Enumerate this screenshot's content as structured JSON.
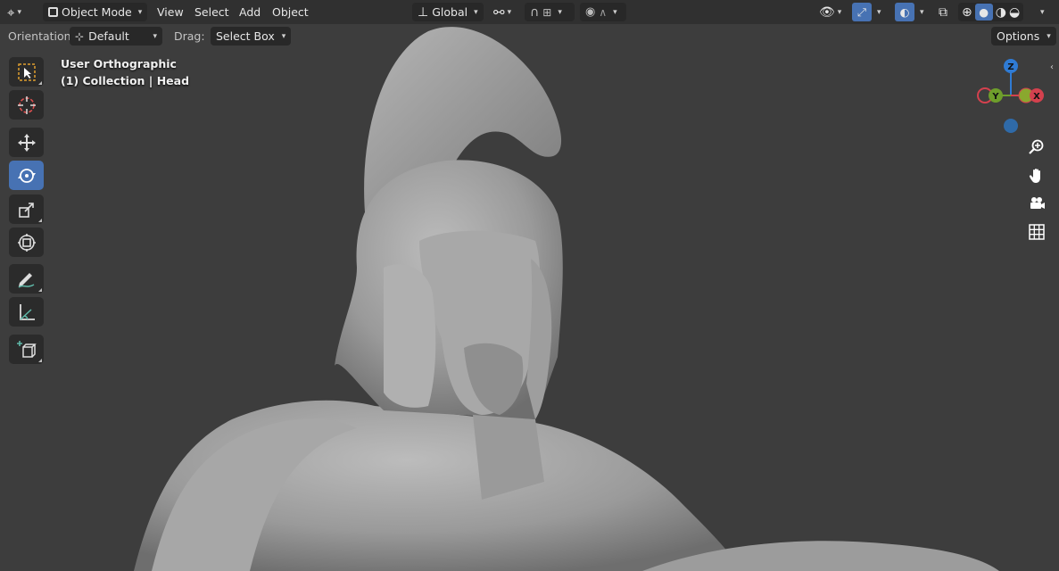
{
  "header": {
    "mode_label": "Object Mode",
    "menus": [
      "View",
      "Select",
      "Add",
      "Object"
    ],
    "transform_orientation": "Global"
  },
  "tool_settings": {
    "orientation_label": "Orientation:",
    "orientation_value": "Default",
    "drag_label": "Drag:",
    "drag_value": "Select Box",
    "options_label": "Options"
  },
  "viewport": {
    "view_name": "User Orthographic",
    "collection_info": "(1) Collection | Head"
  },
  "gizmo": {
    "axes": {
      "z": "Z",
      "y": "Y",
      "x": "X"
    },
    "colors": {
      "x": "#d4414e",
      "y": "#6e9e2b",
      "z": "#2f7bd4",
      "accent": "#4772b3"
    }
  },
  "left_tools": [
    {
      "name": "select-box-tool",
      "icon": "select-box-icon",
      "active": false
    },
    {
      "name": "cursor-tool",
      "icon": "cursor-icon",
      "active": false
    },
    {
      "name": "move-tool",
      "icon": "move-icon",
      "active": false
    },
    {
      "name": "rotate-tool",
      "icon": "rotate-icon",
      "active": true
    },
    {
      "name": "scale-tool",
      "icon": "scale-icon",
      "active": false
    },
    {
      "name": "transform-tool",
      "icon": "transform-icon",
      "active": false
    },
    {
      "name": "annotate-tool",
      "icon": "annotate-icon",
      "active": false
    },
    {
      "name": "measure-tool",
      "icon": "measure-icon",
      "active": false
    },
    {
      "name": "add-cube-tool",
      "icon": "add-cube-icon",
      "active": false
    }
  ],
  "right_nav": [
    "zoom-icon",
    "pan-hand-icon",
    "camera-icon",
    "grid-icon"
  ]
}
